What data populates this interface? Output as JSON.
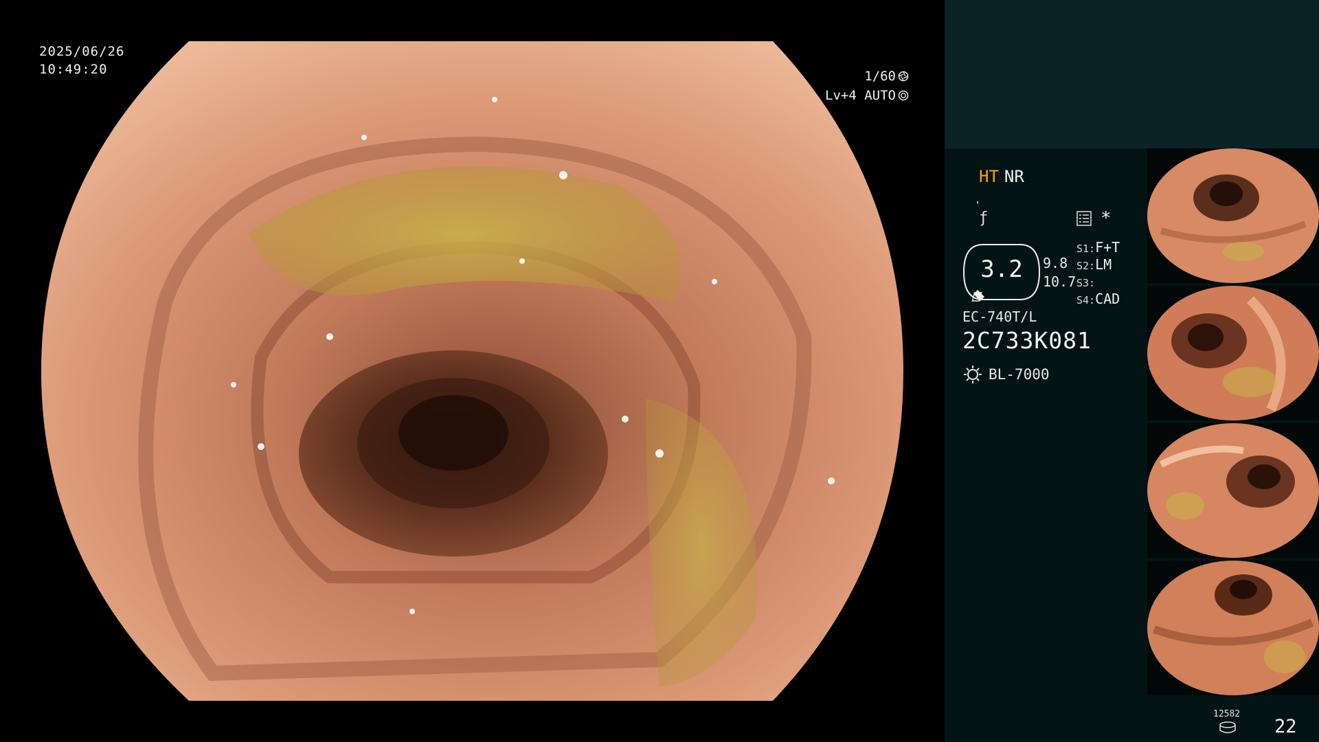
{
  "overlay": {
    "date": "2025/06/26",
    "time": "10:49:20",
    "shutter": "1/60",
    "level": "Lv+4 AUTO",
    "shutter_icon": "aperture-icon",
    "iris_icon": "iris-icon"
  },
  "panel": {
    "mode_ht": "HT",
    "mode_nr": "NR",
    "symbol1": "ᡃ",
    "symbol2": "ƒ",
    "menu_icon": "menu-list-icon",
    "asterisk": "*",
    "gauge_value": "3.2",
    "gauge_right_top": "9.8",
    "gauge_right_bottom": "10.7",
    "settings": [
      {
        "key": "S1:",
        "value": "F+T"
      },
      {
        "key": "S2:",
        "value": "LM"
      },
      {
        "key": "S3:",
        "value": ""
      },
      {
        "key": "S4:",
        "value": "CAD"
      }
    ],
    "model": "EC-740T/L",
    "serial": "2C733K081",
    "light_icon": "sun-icon",
    "light_source": "BL-7000"
  },
  "footer": {
    "image_count": "12582",
    "page": "22"
  },
  "colors": {
    "accent_orange": "#f4a418",
    "panel_bg": "#041414",
    "panel_top_bg": "#0b2226"
  }
}
